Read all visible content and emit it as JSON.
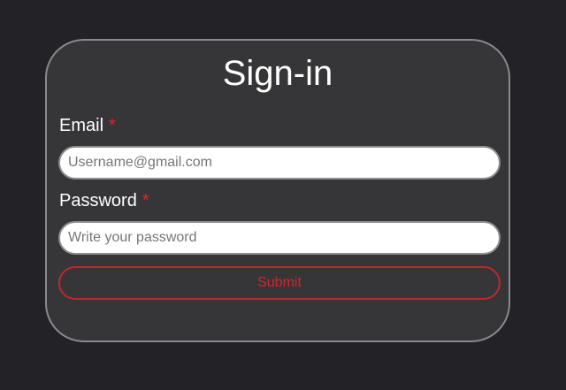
{
  "form": {
    "title": "Sign-in",
    "email": {
      "label": "Email",
      "required_mark": "*",
      "placeholder": "Username@gmail.com",
      "value": ""
    },
    "password": {
      "label": "Password",
      "required_mark": "*",
      "placeholder": "Write your password",
      "value": ""
    },
    "submit_label": "Submit"
  },
  "colors": {
    "background": "#232226",
    "card": "#363538",
    "required": "#e0242a",
    "submit_accent": "#c0282e"
  }
}
